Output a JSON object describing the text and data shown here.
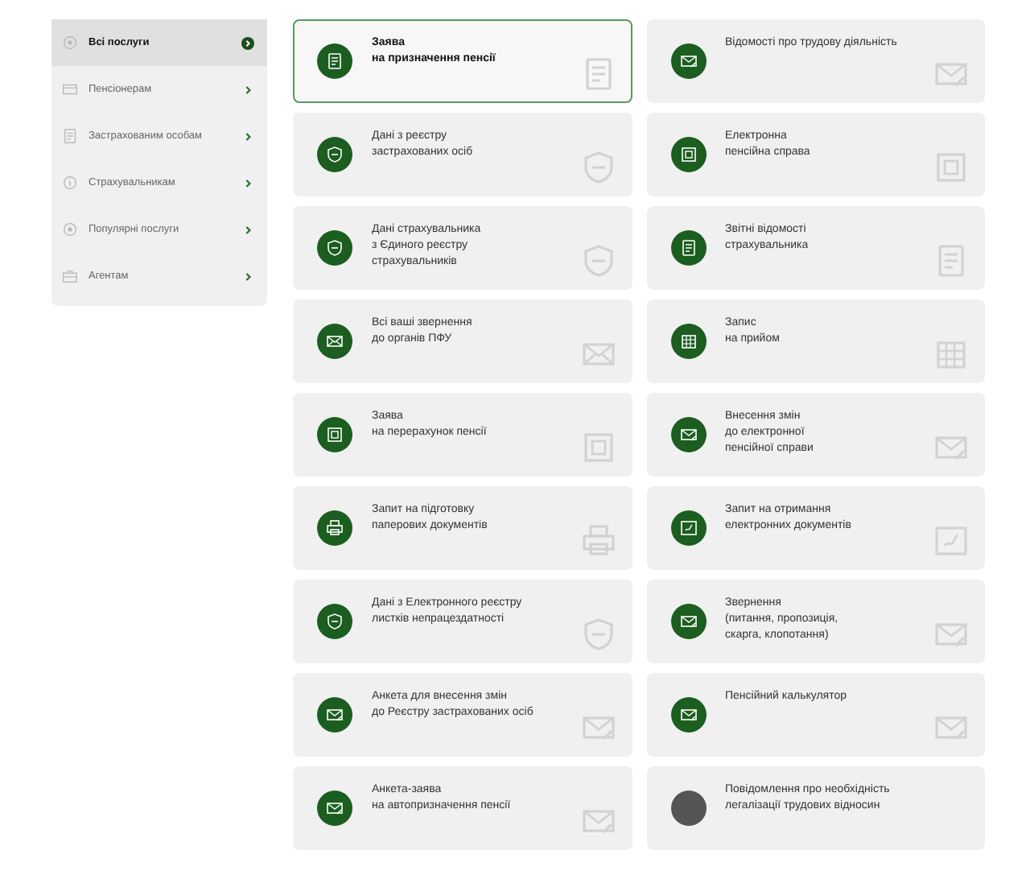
{
  "sidebar": {
    "items": [
      {
        "label": "Всі послуги",
        "kind": "circle",
        "selected": true
      },
      {
        "label": "Пенсіонерам",
        "kind": "card",
        "selected": false
      },
      {
        "label": "Застрахованим особам",
        "kind": "document",
        "selected": false
      },
      {
        "label": "Страхувальникам",
        "kind": "info",
        "selected": false
      },
      {
        "label": "Популярні послуги",
        "kind": "circle",
        "selected": false
      },
      {
        "label": "Агентам",
        "kind": "briefcase",
        "selected": false
      }
    ]
  },
  "services": [
    {
      "text": "Заява\nна призначення пенсії",
      "kind": "document",
      "color": "#1b5e20",
      "selected": true
    },
    {
      "text": "Відомості про трудову діяльність",
      "kind": "mail",
      "color": "#1b5e20",
      "selected": false
    },
    {
      "text": "Дані з реєстру\nзастрахованих осіб",
      "kind": "shield",
      "color": "#1b5e20",
      "selected": false
    },
    {
      "text": "Електронна\nпенсійна справа",
      "kind": "folder",
      "color": "#1b5e20",
      "selected": false
    },
    {
      "text": "Дані страхувальника\nз Єдиного реєстру\nстрахувальників",
      "kind": "shield",
      "color": "#1b5e20",
      "selected": false
    },
    {
      "text": "Звітні відомості\nстрахувальника",
      "kind": "document",
      "color": "#1b5e20",
      "selected": false
    },
    {
      "text": "Всі ваші звернення\nдо органів ПФУ",
      "kind": "envelope",
      "color": "#1b5e20",
      "selected": false
    },
    {
      "text": "Запис\nна прийом",
      "kind": "calendar",
      "color": "#1b5e20",
      "selected": false
    },
    {
      "text": "Заява\nна перерахунок пенсії",
      "kind": "folder",
      "color": "#1b5e20",
      "selected": false
    },
    {
      "text": "Внесення змін\nдо електронної\nпенсійної справи",
      "kind": "mail",
      "color": "#1b5e20",
      "selected": false
    },
    {
      "text": "Запит на підготовку\nпаперових документів",
      "kind": "printer",
      "color": "#1b5e20",
      "selected": false
    },
    {
      "text": "Запит на отримання\nелектронних документів",
      "kind": "signature",
      "color": "#1b5e20",
      "selected": false
    },
    {
      "text": "Дані з Електронного реєстру\nлистків непрацездатності",
      "kind": "shield",
      "color": "#1b5e20",
      "selected": false
    },
    {
      "text": "Звернення\n(питання, пропозиція,\nскарга, клопотання)",
      "kind": "mail",
      "color": "#1b5e20",
      "selected": false
    },
    {
      "text": "Анкета для внесення змін\nдо Реєстру застрахованих осіб",
      "kind": "mail",
      "color": "#1b5e20",
      "selected": false
    },
    {
      "text": "Пенсійний калькулятор",
      "kind": "mail",
      "color": "#1b5e20",
      "selected": false
    },
    {
      "text": "Анкета-заява\nна автопризначення пенсії",
      "kind": "mail",
      "color": "#1b5e20",
      "selected": false
    },
    {
      "text": "Повідомлення про необхідність\nлегалізації трудових відносин",
      "kind": "none",
      "color": "#555555",
      "selected": false
    }
  ]
}
